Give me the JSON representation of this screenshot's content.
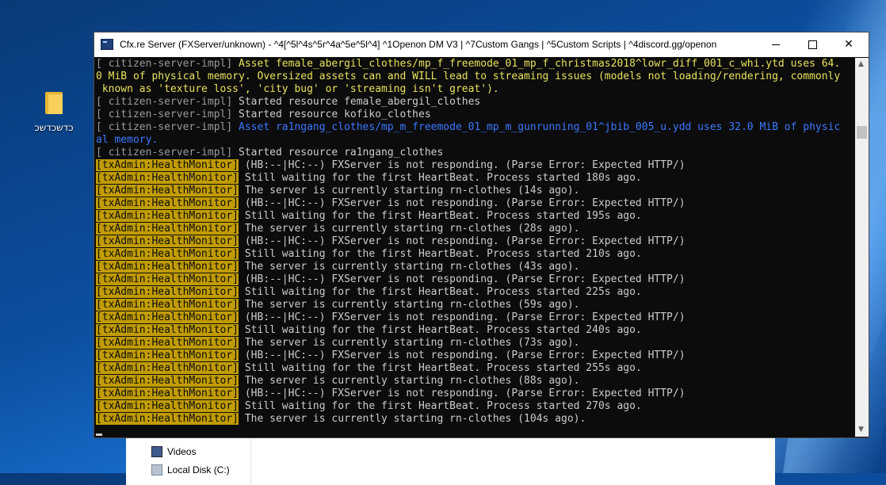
{
  "desktop": {
    "icon_label": "כדשכדשכ"
  },
  "explorer": {
    "items": [
      "Videos",
      "Local Disk (C:)"
    ]
  },
  "window": {
    "title": "Cfx.re Server (FXServer/unknown) - ^4[^5l^4s^5r^4a^5e^5l^4] ^1Openon DM V3 | ^7Custom Gangs | ^5Custom Scripts | ^4discord.gg/openon",
    "minimize": "—",
    "maximize": "☐",
    "close": "✕"
  },
  "console": {
    "lines": [
      {
        "tag": "[ citizen-server-impl]",
        "text": " Asset female_abergil_clothes/mp_f_freemode_01_mp_f_christmas2018^lowr_diff_001_c_whi.ytd uses 64.",
        "style": "yellow"
      },
      {
        "tag": "",
        "text": "0 MiB of physical memory. Oversized assets can and WILL lead to streaming issues (models not loading/rendering, commonly",
        "style": "yellow"
      },
      {
        "tag": "",
        "text": " known as 'texture loss', 'city bug' or 'streaming isn't great').",
        "style": "yellow"
      },
      {
        "tag": "[ citizen-server-impl]",
        "text": " Started resource female_abergil_clothes",
        "style": "normal"
      },
      {
        "tag": "[ citizen-server-impl]",
        "text": " Started resource kofiko_clothes",
        "style": "normal"
      },
      {
        "tag": "[ citizen-server-impl]",
        "text": " Asset ra1ngang_clothes/mp_m_freemode_01_mp_m_gunrunning_01^jbib_005_u.ydd uses 32.0 MiB of physic",
        "style": "blue"
      },
      {
        "tag": "",
        "text": "al memory.",
        "style": "blue"
      },
      {
        "tag": "[ citizen-server-impl]",
        "text": " Started resource ra1ngang_clothes",
        "style": "normal"
      },
      {
        "tag": "[txAdmin:HealthMonitor]",
        "text": " (HB:--|HC:--) FXServer is not responding. (Parse Error: Expected HTTP/)",
        "style": "hm"
      },
      {
        "tag": "[txAdmin:HealthMonitor]",
        "text": " Still waiting for the first HeartBeat. Process started 180s ago.",
        "style": "hm"
      },
      {
        "tag": "[txAdmin:HealthMonitor]",
        "text": " The server is currently starting rn-clothes (14s ago).",
        "style": "hm"
      },
      {
        "tag": "[txAdmin:HealthMonitor]",
        "text": " (HB:--|HC:--) FXServer is not responding. (Parse Error: Expected HTTP/)",
        "style": "hm"
      },
      {
        "tag": "[txAdmin:HealthMonitor]",
        "text": " Still waiting for the first HeartBeat. Process started 195s ago.",
        "style": "hm"
      },
      {
        "tag": "[txAdmin:HealthMonitor]",
        "text": " The server is currently starting rn-clothes (28s ago).",
        "style": "hm"
      },
      {
        "tag": "[txAdmin:HealthMonitor]",
        "text": " (HB:--|HC:--) FXServer is not responding. (Parse Error: Expected HTTP/)",
        "style": "hm"
      },
      {
        "tag": "[txAdmin:HealthMonitor]",
        "text": " Still waiting for the first HeartBeat. Process started 210s ago.",
        "style": "hm"
      },
      {
        "tag": "[txAdmin:HealthMonitor]",
        "text": " The server is currently starting rn-clothes (43s ago).",
        "style": "hm"
      },
      {
        "tag": "[txAdmin:HealthMonitor]",
        "text": " (HB:--|HC:--) FXServer is not responding. (Parse Error: Expected HTTP/)",
        "style": "hm"
      },
      {
        "tag": "[txAdmin:HealthMonitor]",
        "text": " Still waiting for the first HeartBeat. Process started 225s ago.",
        "style": "hm"
      },
      {
        "tag": "[txAdmin:HealthMonitor]",
        "text": " The server is currently starting rn-clothes (59s ago).",
        "style": "hm"
      },
      {
        "tag": "[txAdmin:HealthMonitor]",
        "text": " (HB:--|HC:--) FXServer is not responding. (Parse Error: Expected HTTP/)",
        "style": "hm"
      },
      {
        "tag": "[txAdmin:HealthMonitor]",
        "text": " Still waiting for the first HeartBeat. Process started 240s ago.",
        "style": "hm"
      },
      {
        "tag": "[txAdmin:HealthMonitor]",
        "text": " The server is currently starting rn-clothes (73s ago).",
        "style": "hm"
      },
      {
        "tag": "[txAdmin:HealthMonitor]",
        "text": " (HB:--|HC:--) FXServer is not responding. (Parse Error: Expected HTTP/)",
        "style": "hm"
      },
      {
        "tag": "[txAdmin:HealthMonitor]",
        "text": " Still waiting for the first HeartBeat. Process started 255s ago.",
        "style": "hm"
      },
      {
        "tag": "[txAdmin:HealthMonitor]",
        "text": " The server is currently starting rn-clothes (88s ago).",
        "style": "hm"
      },
      {
        "tag": "[txAdmin:HealthMonitor]",
        "text": " (HB:--|HC:--) FXServer is not responding. (Parse Error: Expected HTTP/)",
        "style": "hm"
      },
      {
        "tag": "[txAdmin:HealthMonitor]",
        "text": " Still waiting for the first HeartBeat. Process started 270s ago.",
        "style": "hm"
      },
      {
        "tag": "[txAdmin:HealthMonitor]",
        "text": " The server is currently starting rn-clothes (104s ago).",
        "style": "hm"
      }
    ]
  },
  "colors": {
    "console_bg": "#0c0c0c",
    "console_text": "#cccccc",
    "warning_text": "#e8e25c",
    "blue_text": "#3b78ff",
    "health_tag_bg": "#c19c00"
  },
  "icons": {
    "desktop_folder": "folder-icon",
    "app": "console-app-icon",
    "videos": "videos-icon",
    "disk": "disk-icon"
  }
}
